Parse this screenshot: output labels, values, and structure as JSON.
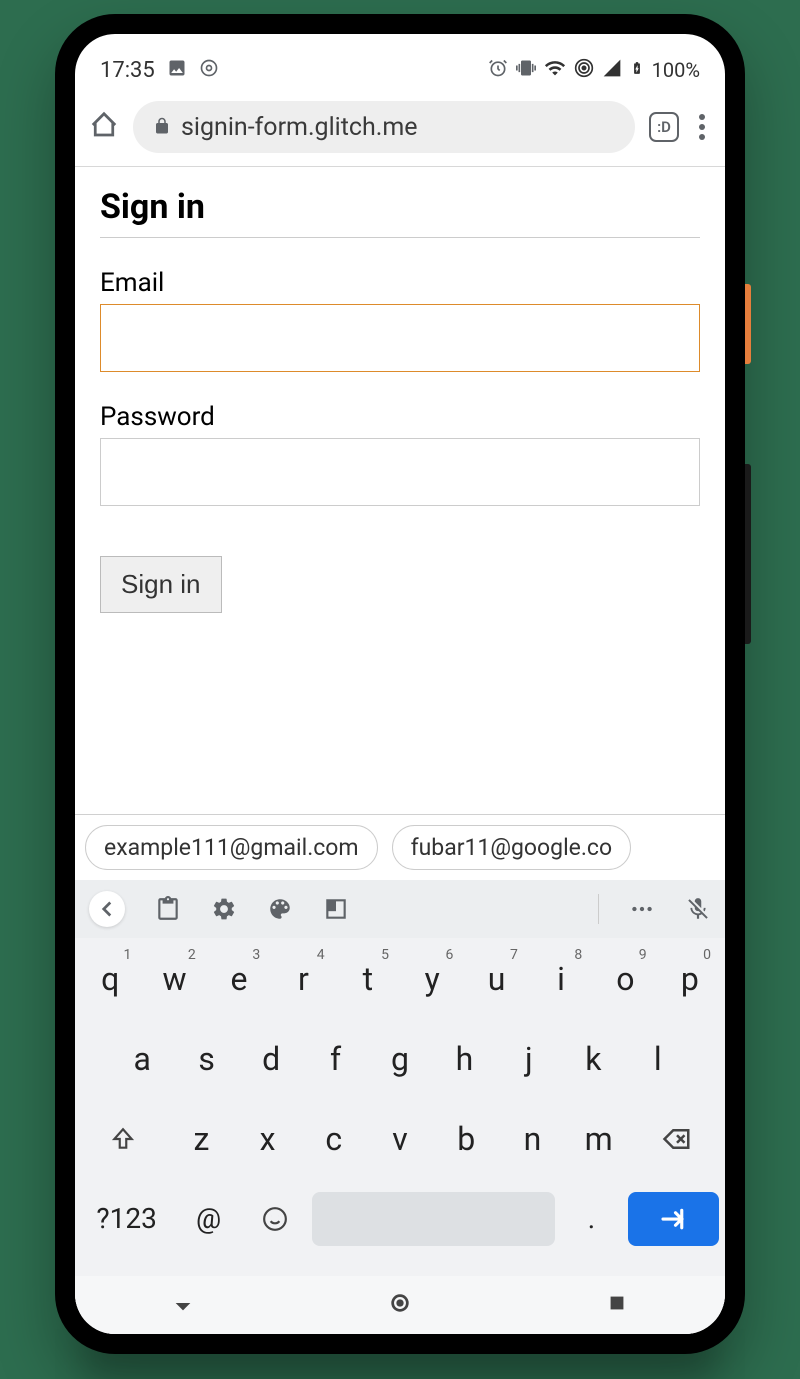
{
  "status_bar": {
    "time": "17:35",
    "battery": "100%"
  },
  "browser": {
    "url": "signin-form.glitch.me",
    "tab_count": ":D"
  },
  "page": {
    "title": "Sign in",
    "email_label": "Email",
    "email_value": "",
    "password_label": "Password",
    "password_value": "",
    "submit_label": "Sign in"
  },
  "keyboard": {
    "suggestions": [
      "example111@gmail.com",
      "fubar11@google.co"
    ],
    "row1": [
      {
        "k": "q",
        "s": "1"
      },
      {
        "k": "w",
        "s": "2"
      },
      {
        "k": "e",
        "s": "3"
      },
      {
        "k": "r",
        "s": "4"
      },
      {
        "k": "t",
        "s": "5"
      },
      {
        "k": "y",
        "s": "6"
      },
      {
        "k": "u",
        "s": "7"
      },
      {
        "k": "i",
        "s": "8"
      },
      {
        "k": "o",
        "s": "9"
      },
      {
        "k": "p",
        "s": "0"
      }
    ],
    "row2": [
      "a",
      "s",
      "d",
      "f",
      "g",
      "h",
      "j",
      "k",
      "l"
    ],
    "row3": [
      "z",
      "x",
      "c",
      "v",
      "b",
      "n",
      "m"
    ],
    "sym_label": "?123",
    "at_label": "@",
    "period_label": "."
  }
}
